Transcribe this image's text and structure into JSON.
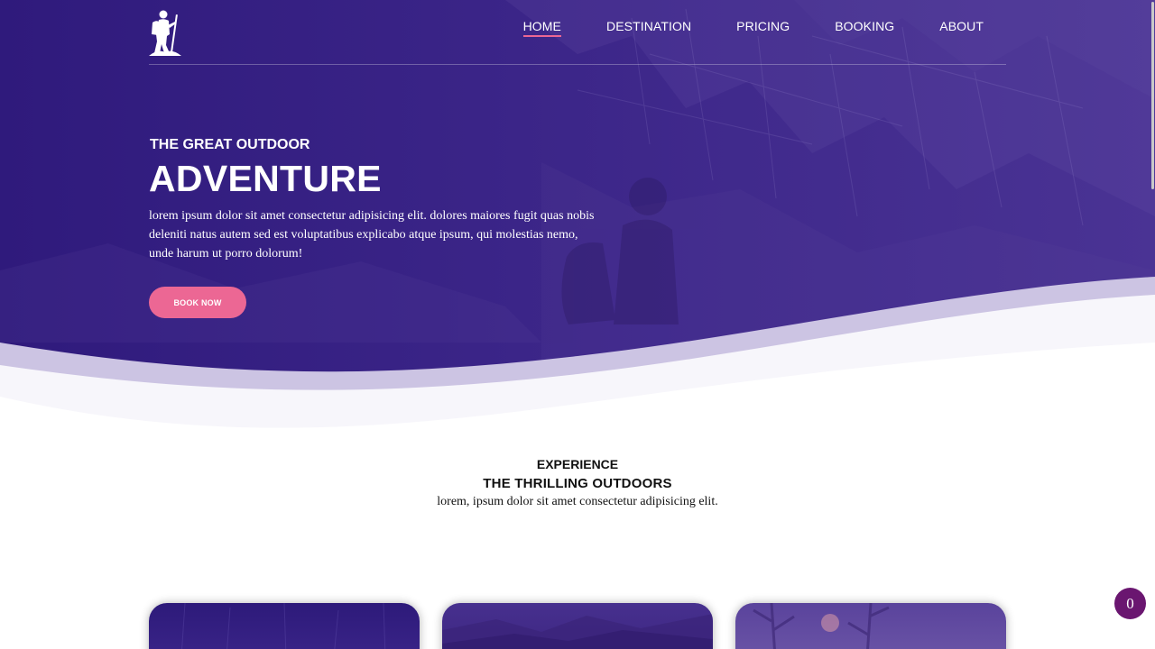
{
  "nav": {
    "logo_icon": "hiker-icon",
    "links": [
      {
        "label": "HOME",
        "active": true
      },
      {
        "label": "DESTINATION",
        "active": false
      },
      {
        "label": "PRICING",
        "active": false
      },
      {
        "label": "BOOKING",
        "active": false
      },
      {
        "label": "ABOUT",
        "active": false
      }
    ]
  },
  "hero": {
    "kicker": "THE GREAT OUTDOOR",
    "title": "ADVENTURE",
    "text": "lorem ipsum dolor sit amet consectetur adipisicing elit. dolores maiores fugit quas nobis deleniti natus autem sed est voluptatibus explicabo atque ipsum, qui molestias nemo, unde harum ut porro dolorum!",
    "button_label": "BOOK NOW"
  },
  "section": {
    "kicker": "EXPERIENCE",
    "title": "THE THRILLING OUTDOORS",
    "text": "lorem, ipsum dolor sit amet consectetur adipisicing elit."
  },
  "cards": [
    {
      "image": "outdoor-photo"
    },
    {
      "image": "mountain-photo"
    },
    {
      "image": "forest-photo"
    }
  ],
  "badge": {
    "count": "0"
  },
  "colors": {
    "hero_overlay": "#3a2287",
    "accent_pink": "#ec6794",
    "badge_purple": "#6a1670"
  }
}
